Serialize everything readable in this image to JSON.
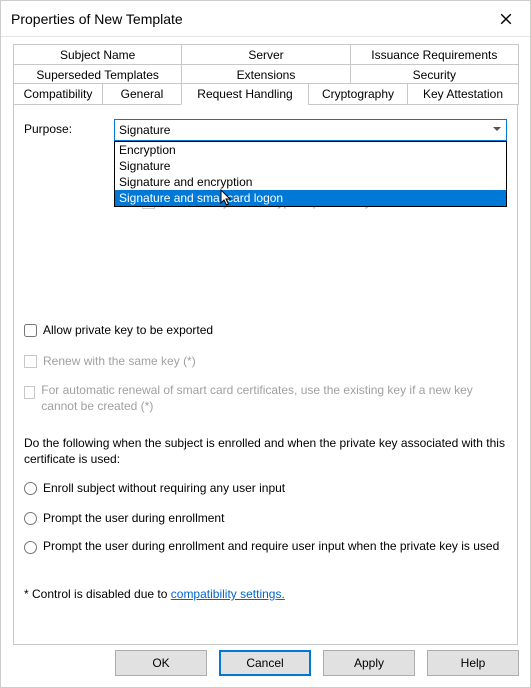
{
  "window": {
    "title": "Properties of New Template"
  },
  "tabs": {
    "row1": [
      "Subject Name",
      "Server",
      "Issuance Requirements"
    ],
    "row2": [
      "Superseded Templates",
      "Extensions",
      "Security"
    ],
    "row3": [
      "Compatibility",
      "General",
      "Request Handling",
      "Cryptography",
      "Key Attestation"
    ]
  },
  "purpose": {
    "label": "Purpose:",
    "selected": "Signature",
    "options": [
      "Encryption",
      "Signature",
      "Signature and encryption",
      "Signature and smartcard logon"
    ],
    "highlighted_index": 3
  },
  "ghost": {
    "archive": "Archive subject's encryption private key"
  },
  "checkboxes": {
    "allow_export": "Allow private key to be exported",
    "renew_same": "Renew with the same key (*)",
    "auto_renew_smartcard": "For automatic renewal of smart card certificates, use the existing key if a new key cannot be created (*)"
  },
  "enroll": {
    "intro": "Do the following when the subject is enrolled and when the private key associated with this certificate is used:",
    "opt1": "Enroll subject without requiring any user input",
    "opt2": "Prompt the user during enrollment",
    "opt3": "Prompt the user during enrollment and require user input when the private key is used"
  },
  "footnote": {
    "prefix": "* Control is disabled due to ",
    "link": "compatibility settings."
  },
  "buttons": {
    "ok": "OK",
    "cancel": "Cancel",
    "apply": "Apply",
    "help": "Help"
  }
}
